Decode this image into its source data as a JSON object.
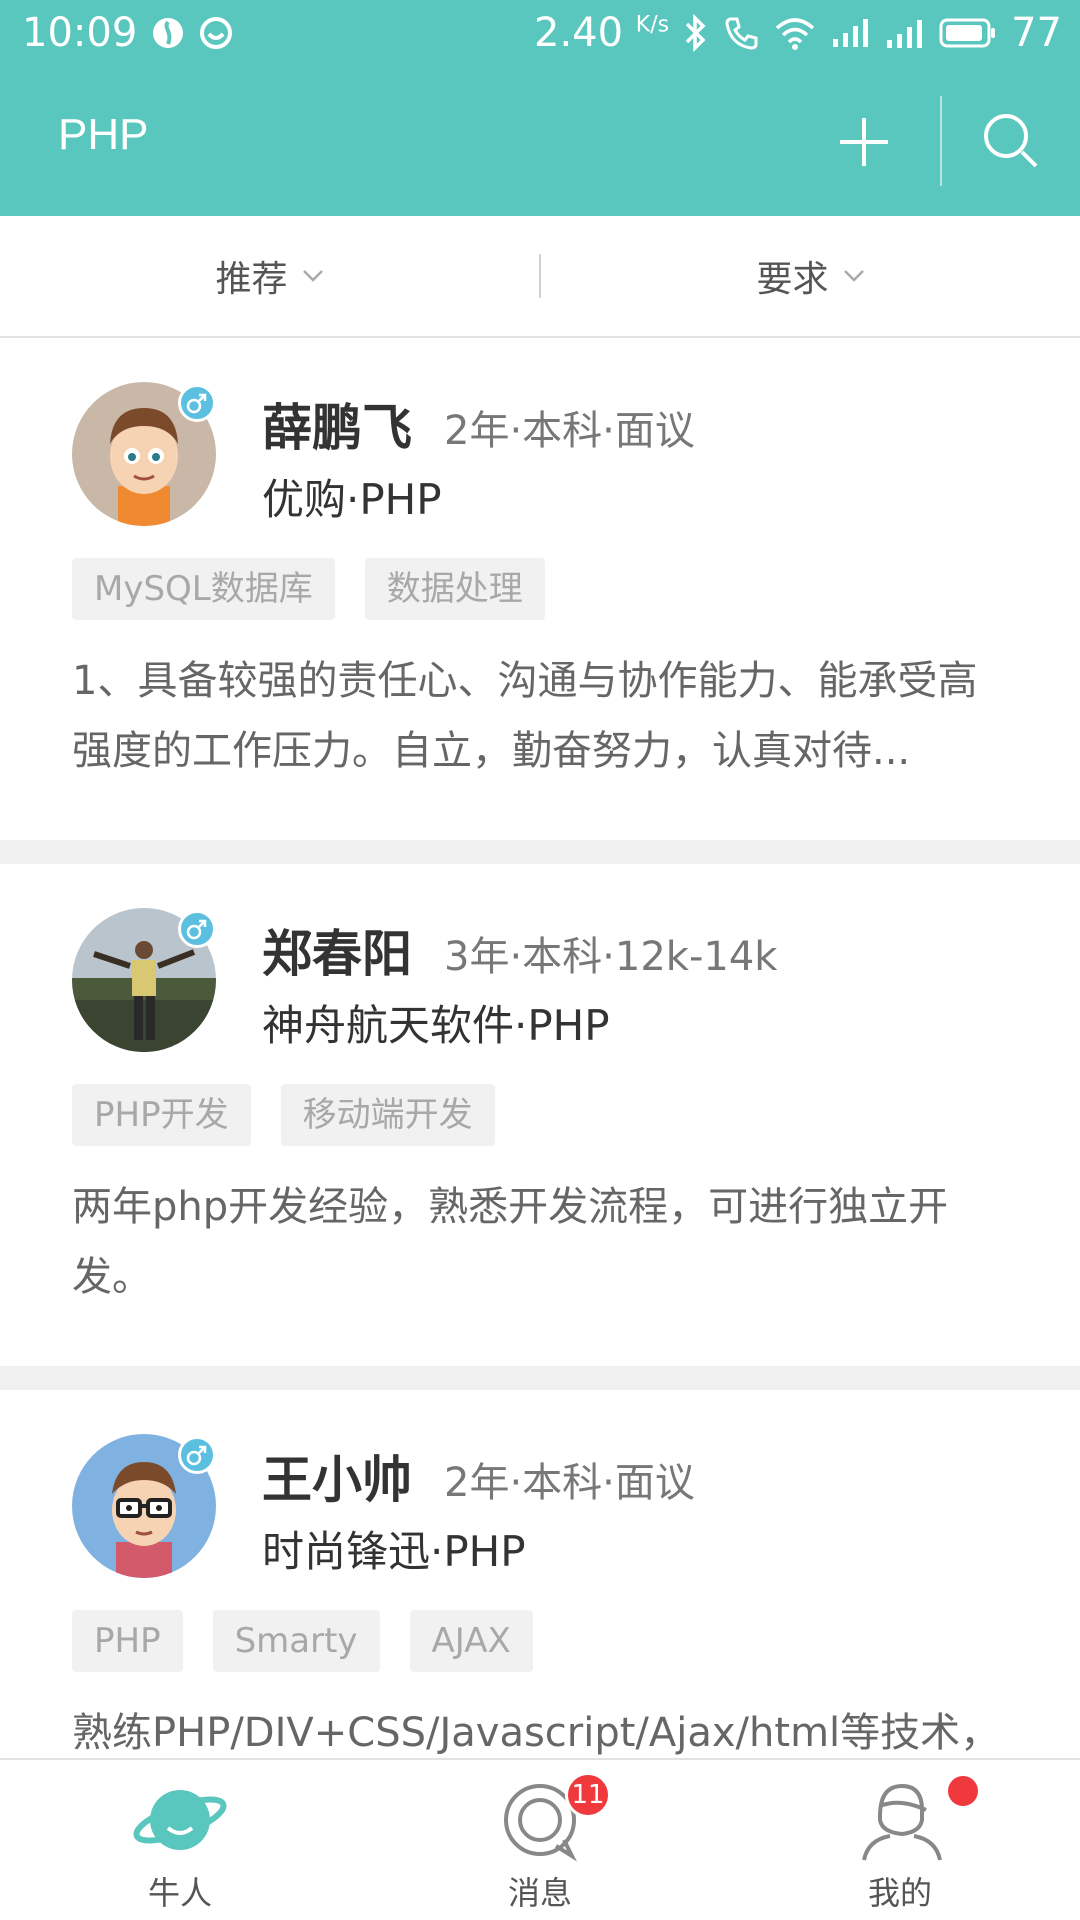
{
  "status_bar": {
    "time": "10:09",
    "speed": "2.40",
    "speed_unit": "K/s",
    "battery": "77"
  },
  "app_bar": {
    "title": "PHP"
  },
  "filters": [
    {
      "label": "推荐"
    },
    {
      "label": "要求"
    }
  ],
  "candidates": [
    {
      "name": "薛鹏飞",
      "meta": "2年·本科·面议",
      "company": "优购·PHP",
      "tags": [
        "MySQL数据库",
        "数据处理"
      ],
      "description": "1、具备较强的责任心、沟通与协作能力、能承受高强度的工作压力。自立，勤奋努力，认真对待..."
    },
    {
      "name": "郑春阳",
      "meta": "3年·本科·12k-14k",
      "company": "神舟航天软件·PHP",
      "tags": [
        "PHP开发",
        "移动端开发"
      ],
      "description": "两年php开发经验，熟悉开发流程，可进行独立开发。"
    },
    {
      "name": "王小帅",
      "meta": "2年·本科·面议",
      "company": "时尚锋迅·PHP",
      "tags": [
        "PHP",
        "Smarty",
        "AJAX"
      ],
      "description": "熟练PHP/DIV+CSS/Javascript/Ajax/html等技术，"
    }
  ],
  "tab_bar": {
    "tabs": [
      {
        "label": "牛人"
      },
      {
        "label": "消息",
        "badge": "11"
      },
      {
        "label": "我的"
      }
    ]
  },
  "colors": {
    "accent": "#5ac7bf",
    "badge": "#f0393c"
  }
}
